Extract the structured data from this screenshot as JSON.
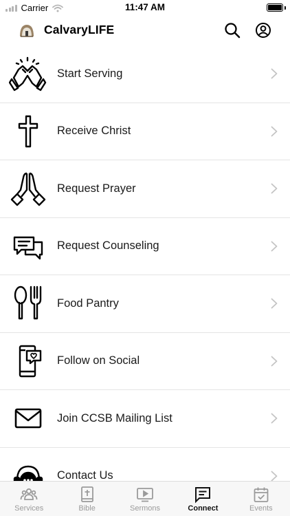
{
  "status_bar": {
    "carrier": "Carrier",
    "time": "11:47 AM",
    "battery_level": 1.0
  },
  "header": {
    "title": "CalvaryLIFE",
    "icons": [
      "search-icon",
      "account-icon"
    ]
  },
  "menu": {
    "items": [
      {
        "label": "Start Serving",
        "icon": "serving-hands-icon"
      },
      {
        "label": "Receive Christ",
        "icon": "cross-icon"
      },
      {
        "label": "Request Prayer",
        "icon": "praying-hands-icon"
      },
      {
        "label": "Request Counseling",
        "icon": "chat-bubbles-icon"
      },
      {
        "label": "Food Pantry",
        "icon": "spoon-fork-icon"
      },
      {
        "label": "Follow on Social",
        "icon": "phone-social-icon"
      },
      {
        "label": "Join CCSB Mailing List",
        "icon": "envelope-icon"
      },
      {
        "label": "Contact Us",
        "icon": "headset-chat-icon"
      }
    ]
  },
  "tab_bar": {
    "tabs": [
      {
        "label": "Services",
        "icon": "people-icon",
        "active": false
      },
      {
        "label": "Bible",
        "icon": "bible-icon",
        "active": false
      },
      {
        "label": "Sermons",
        "icon": "video-play-icon",
        "active": false
      },
      {
        "label": "Connect",
        "icon": "message-icon",
        "active": true
      },
      {
        "label": "Events",
        "icon": "calendar-check-icon",
        "active": false
      }
    ]
  },
  "colors": {
    "active_tab": "#111111",
    "inactive_tab": "#9a9a9a",
    "divider": "#e4e4e4",
    "tab_bar_bg": "#f7f7f7"
  }
}
